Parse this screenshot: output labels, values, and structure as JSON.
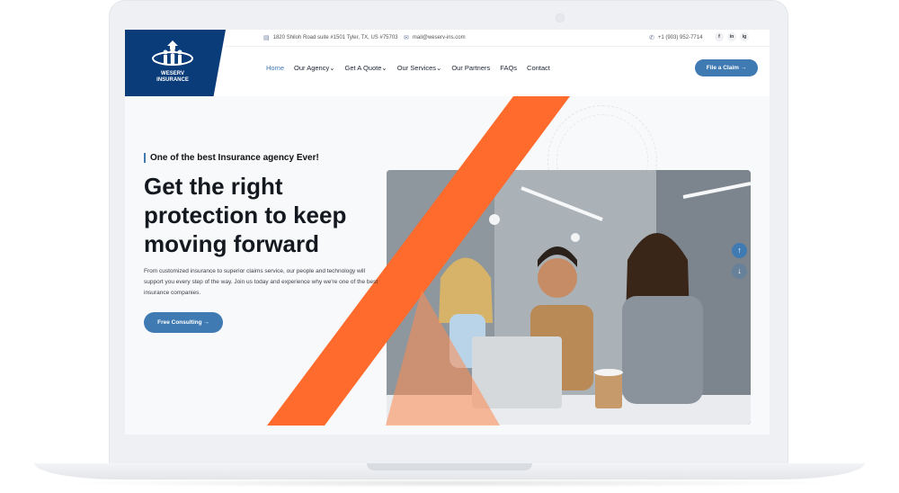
{
  "brand": {
    "name_line1": "WESERV",
    "name_line2": "INSURANCE",
    "color": "#0b3c7a"
  },
  "topbar": {
    "address": "1820 Shiloh Road suite #1501 Tyler, TX, US #75703",
    "email": "mail@weserv-ins.com",
    "phone": "+1 (903) 952-7714",
    "social": [
      "f",
      "in",
      "ig"
    ]
  },
  "nav": {
    "items": [
      "Home",
      "Our Agency",
      "Get A Quote",
      "Our Services",
      "Our Partners",
      "FAQs",
      "Contact"
    ],
    "chevron": "⌄",
    "claim_button": "File a Claim →"
  },
  "hero": {
    "kicker": "One of the best Insurance agency Ever!",
    "headline_1": "Get the right",
    "headline_2": "protection to keep",
    "headline_3": "moving forward",
    "lead": "From customized insurance to superior claims service, our people and technology will support you every step of the way. Join us today and experience why we're one of the best insurance companies.",
    "cta": "Free Consulting →"
  },
  "scroll": {
    "up": "↑",
    "down": "↓"
  },
  "colors": {
    "accent": "#3f7ab3",
    "orange": "#ff6b2c"
  }
}
